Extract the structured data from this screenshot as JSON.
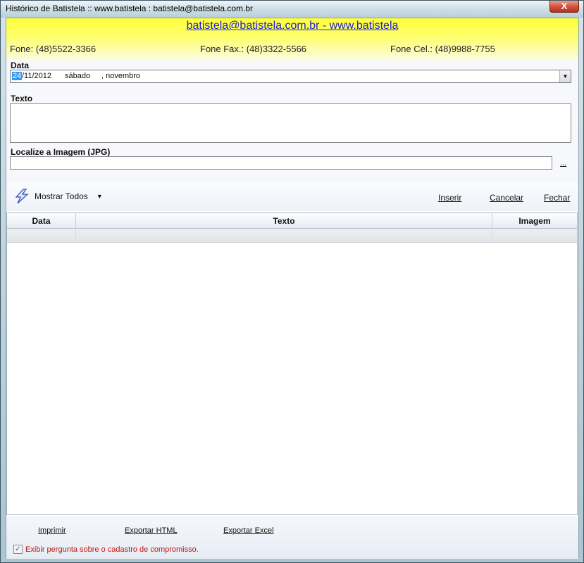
{
  "window": {
    "title": "Histórico de Batistela :: www.batistela : batistela@batistela.com.br",
    "close_glyph": "X"
  },
  "header": {
    "link": "batistela@batistela.com.br - www.batistela",
    "phone": "Fone: (48)5522-3366",
    "fax": "Fone Fax.: (48)3322-5566",
    "cell": "Fone Cel.: (48)9988-7755"
  },
  "form": {
    "date_label": "Data",
    "date_day": "24",
    "date_rest": "/11/2012",
    "date_weekday": "sábado",
    "date_month": ", novembro",
    "text_label": "Texto",
    "text_value": "",
    "image_label": "Localize a Imagem (JPG)",
    "image_value": "",
    "browse_label": "..."
  },
  "toolbar": {
    "mostrar_label": "Mostrar Todos",
    "inserir": "Inserir",
    "cancelar": "Cancelar",
    "fechar": "Fechar"
  },
  "grid": {
    "columns": [
      "Data",
      "Texto",
      "Imagem"
    ],
    "rows": [
      [
        "",
        "",
        ""
      ]
    ]
  },
  "footer": {
    "imprimir": "Imprimir",
    "exportar_html": "Exportar HTML",
    "exportar_excel": "Exportar Excel",
    "checkbox_label": "Exibir pergunta sobre o cadastro de compromisso.",
    "checkbox_checked": true
  },
  "colors": {
    "header_yellow": "#ffff3a",
    "link_blue": "#1b1fd6",
    "checkbox_text_red": "#c0150c"
  }
}
